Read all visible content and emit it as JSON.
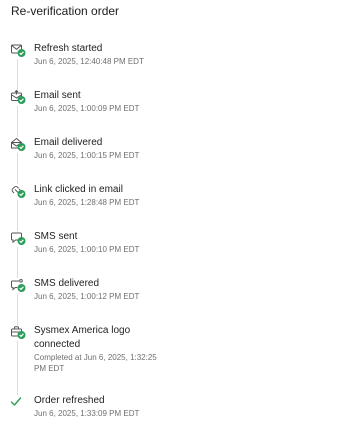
{
  "header": {
    "title": "Re-verification order"
  },
  "events": [
    {
      "icon": "email-check-icon",
      "title": "Refresh started",
      "meta": "Jun 6, 2025, 12:40:48 PM EDT"
    },
    {
      "icon": "email-sent-icon",
      "title": "Email sent",
      "meta": "Jun 6, 2025, 1:00:09 PM EDT"
    },
    {
      "icon": "email-delivered-icon",
      "title": "Email delivered",
      "meta": "Jun 6, 2025, 1:00:15 PM EDT"
    },
    {
      "icon": "link-clicked-icon",
      "title": "Link clicked in email",
      "meta": "Jun 6, 2025, 1:28:48 PM EDT"
    },
    {
      "icon": "sms-sent-icon",
      "title": "SMS sent",
      "meta": "Jun 6, 2025, 1:00:10 PM EDT"
    },
    {
      "icon": "sms-delivered-icon",
      "title": "SMS delivered",
      "meta": "Jun 6, 2025, 1:00:12 PM EDT"
    },
    {
      "icon": "connected-icon",
      "title": "Sysmex America logo connected",
      "meta": "Completed at Jun 6, 2025, 1:32:25 PM EDT"
    },
    {
      "icon": "checkmark-icon",
      "title": "Order refreshed",
      "meta": "Jun 6, 2025, 1:33:09 PM EDT"
    }
  ],
  "colors": {
    "success": "#2e9d5b",
    "icon_stroke": "#555555",
    "line": "#dcdcdc"
  }
}
